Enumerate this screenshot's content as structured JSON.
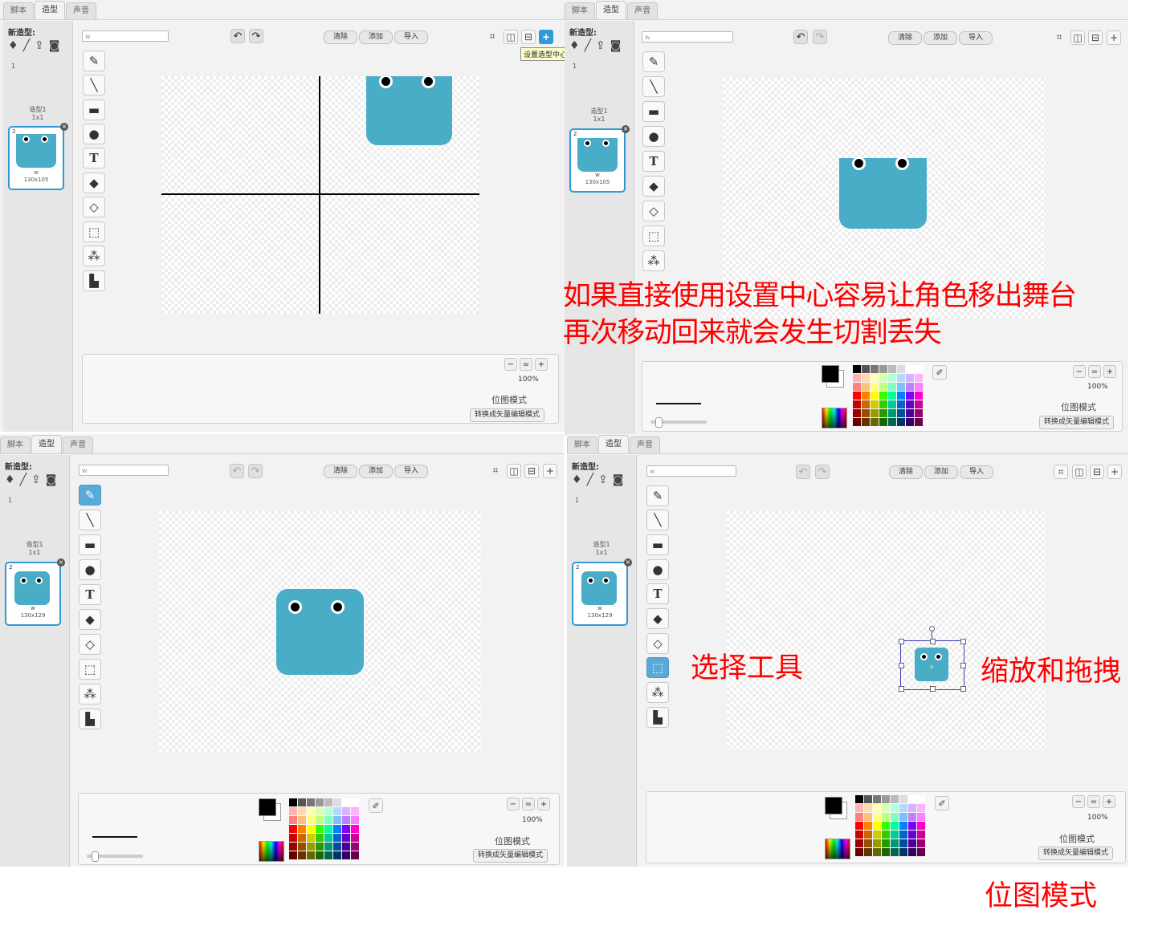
{
  "common": {
    "tabs": [
      "脚本",
      "造型",
      "声音"
    ],
    "new_costume_label": "新造型:",
    "new_costume_icons": [
      "paint-sprite-icon",
      "pencil-icon",
      "upload-icon",
      "camera-icon"
    ],
    "costume_number": "1",
    "costume_title": "造型1",
    "costume_title_size": "1x1",
    "costume_index": "2",
    "costume_delete": "×",
    "costume_name_value": "w",
    "undo": "↶",
    "redo": "↷",
    "clear_label": "清除",
    "add_label": "添加",
    "import_label": "导入",
    "crop_icon": "⌗",
    "flip_h_icon": "◫",
    "flip_v_icon": "⊟",
    "center_icon": "+",
    "tools": [
      "✎",
      "╲",
      "▬",
      "●",
      "T",
      "◆",
      "◇",
      "⬚",
      "⁂",
      "▙"
    ],
    "zoom_out": "−",
    "zoom_reset": "=",
    "zoom_in": "+",
    "zoom_percent": "100%",
    "mode_label": "位图模式",
    "convert_label": "转换成矢量编辑模式",
    "picker_icon": "✐"
  },
  "panels": [
    {
      "thumb_size": "130x105"
    },
    {
      "thumb_size": "130x105"
    },
    {
      "thumb_size": "130x129"
    },
    {
      "thumb_size": "130x129"
    }
  ],
  "tooltip": "设置造型中心",
  "annotations": {
    "center_warning_line1": "如果直接使用设置中心容易让角色移出舞台",
    "center_warning_line2": "再次移动回来就会发生切割丢失",
    "select_tool": "选择工具",
    "scale_drag": "缩放和拖拽",
    "bitmap_mode": "位图模式"
  },
  "palette_colors": [
    "#000000",
    "#555555",
    "#777777",
    "#999999",
    "#bbbbbb",
    "#dddddd",
    "#ffffff",
    "#ffffff",
    "#ffb3b3",
    "#ffd9b3",
    "#ffffb3",
    "#d9ffb3",
    "#b3ffd9",
    "#b3d9ff",
    "#d9b3ff",
    "#ffb3ff",
    "#ff8080",
    "#ffbf80",
    "#ffff80",
    "#bfff80",
    "#80ffbf",
    "#80bfff",
    "#bf80ff",
    "#ff80ff",
    "#ff0000",
    "#ff8000",
    "#ffff00",
    "#33ff00",
    "#00ff99",
    "#0080ff",
    "#8000ff",
    "#ff00cc",
    "#cc0000",
    "#cc6600",
    "#cccc00",
    "#33cc00",
    "#00cc99",
    "#0066cc",
    "#6600cc",
    "#cc0099",
    "#990000",
    "#994d00",
    "#999900",
    "#269900",
    "#009973",
    "#004d99",
    "#4d0099",
    "#990073",
    "#660000",
    "#663300",
    "#666600",
    "#1a6600",
    "#00664d",
    "#003366",
    "#330066",
    "#66004d"
  ]
}
